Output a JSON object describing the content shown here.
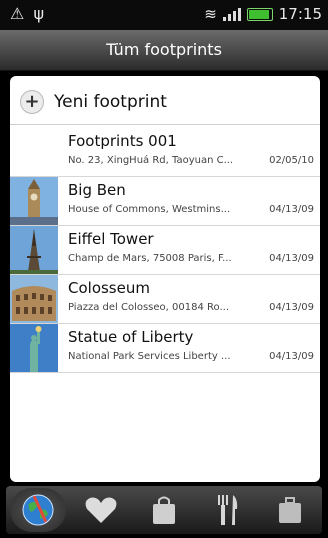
{
  "status": {
    "time": "17:15"
  },
  "header": {
    "title": "Tüm footprints"
  },
  "new_button": {
    "label": "Yeni footprint"
  },
  "items": [
    {
      "title": "Footprints 001",
      "address": "No. 23, XingHuá Rd, Taoyuan C...",
      "date": "02/05/10"
    },
    {
      "title": "Big Ben",
      "address": "House of Commons, Westmins...",
      "date": "04/13/09"
    },
    {
      "title": "Eiffel Tower",
      "address": "Champ de Mars, 75008 Paris, F...",
      "date": "04/13/09"
    },
    {
      "title": "Colosseum",
      "address": "Piazza del Colosseo, 00184 Ro...",
      "date": "04/13/09"
    },
    {
      "title": "Statue of Liberty",
      "address": "National Park Services Liberty ...",
      "date": "04/13/09"
    }
  ],
  "tabs": [
    {
      "icon": "globe-icon",
      "active": true
    },
    {
      "icon": "heart-icon",
      "active": false
    },
    {
      "icon": "shopping-bag-icon",
      "active": false
    },
    {
      "icon": "fork-knife-icon",
      "active": false
    },
    {
      "icon": "suitcase-icon",
      "active": false
    }
  ],
  "colors": {
    "status_bg": "#0b0b0b",
    "title_bg": "#3a3a3a",
    "panel_bg": "#ffffff",
    "battery": "#3fbf2f"
  }
}
